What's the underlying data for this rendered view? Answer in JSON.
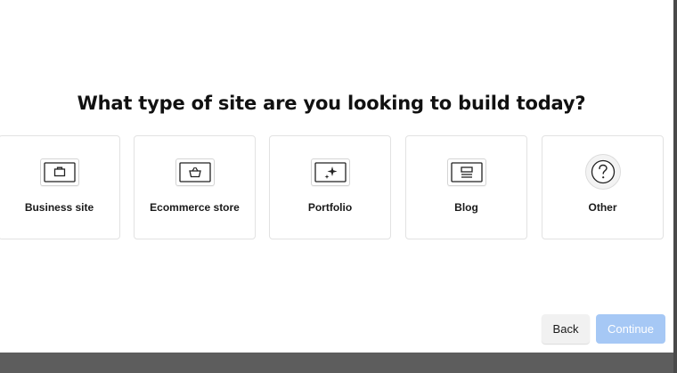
{
  "question": "What type of site are you looking to build today?",
  "options": [
    {
      "label": "Business site",
      "icon": "briefcase-icon"
    },
    {
      "label": "Ecommerce store",
      "icon": "basket-icon"
    },
    {
      "label": "Portfolio",
      "icon": "sparkle-icon"
    },
    {
      "label": "Blog",
      "icon": "blog-layout-icon"
    },
    {
      "label": "Other",
      "icon": "question-mark-icon"
    }
  ],
  "buttons": {
    "back": "Back",
    "continue": "Continue"
  },
  "colors": {
    "primary_disabled": "#a6c8f5",
    "card_border": "#e2e2e2",
    "backdrop": "#5d5d5d"
  }
}
